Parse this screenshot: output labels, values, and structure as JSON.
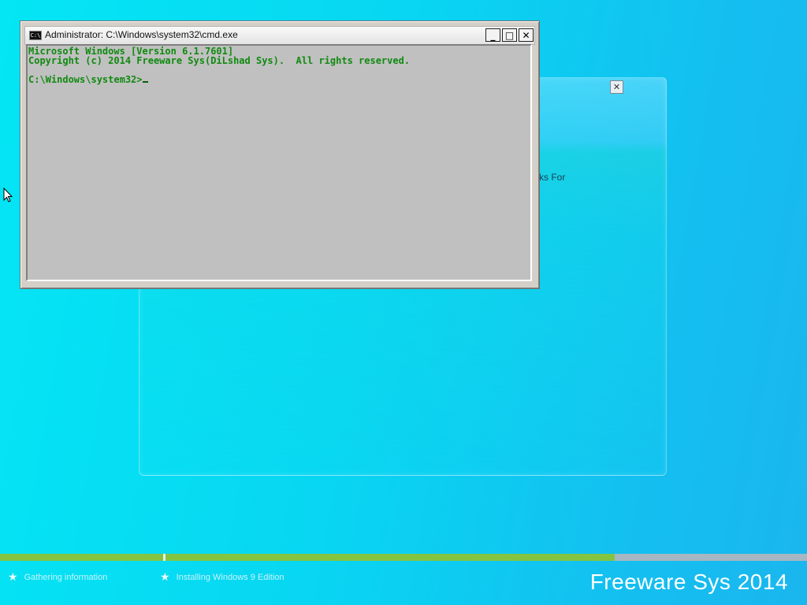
{
  "cmd_window": {
    "title": "Administrator: C:\\Windows\\system32\\cmd.exe",
    "icon_label": "C:\\",
    "buttons": {
      "minimize": "_",
      "maximize": "□",
      "close": "✕"
    },
    "lines": [
      "Microsoft Windows [Version 6.1.7601]",
      "Copyright (c) 2014 Freeware Sys(DiLshad Sys).  All rights reserved.",
      "",
      "C:\\Windows\\system32>"
    ]
  },
  "setup_dialog": {
    "close_label": "✕",
    "partial_text": "ks For"
  },
  "status_bar": {
    "progress_percent": 70,
    "steps": [
      {
        "label": "Gathering information"
      },
      {
        "label": "Installing Windows 9 Edition"
      }
    ],
    "brand": "Freeware Sys 2014"
  }
}
